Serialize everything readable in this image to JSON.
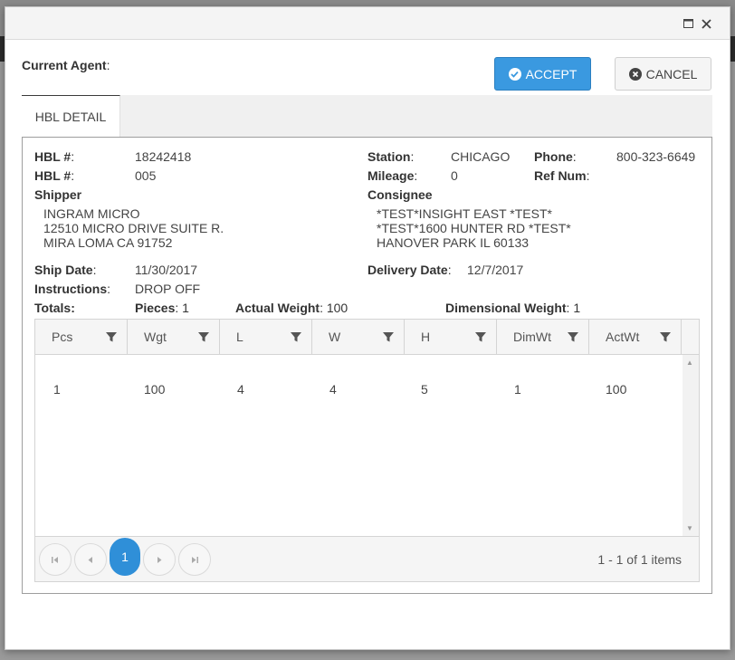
{
  "window": {
    "maximize_icon": "maximize-icon",
    "close_icon": "close-icon"
  },
  "agent": {
    "label": "Current Agent",
    "colon": ":"
  },
  "actions": {
    "accept_label": "ACCEPT",
    "cancel_label": "CANCEL",
    "accept_color": "#3a99e0"
  },
  "tabs": [
    {
      "label": "HBL DETAIL",
      "active": true
    }
  ],
  "detail": {
    "hbl1": {
      "label": "HBL #",
      "value": "18242418"
    },
    "hbl2": {
      "label": "HBL #",
      "value": "005"
    },
    "station": {
      "label": "Station",
      "value": "CHICAGO"
    },
    "phone": {
      "label": "Phone",
      "value": "800-323-6649"
    },
    "mileage": {
      "label": "Mileage",
      "value": "0"
    },
    "ref_num": {
      "label": "Ref Num",
      "value": ""
    },
    "shipper": {
      "label": "Shipper",
      "lines": [
        "INGRAM MICRO",
        "12510 MICRO DRIVE SUITE R.",
        "MIRA LOMA CA 91752"
      ]
    },
    "consignee": {
      "label": "Consignee",
      "lines": [
        "*TEST*INSIGHT EAST *TEST*",
        "*TEST*1600 HUNTER RD *TEST*",
        "HANOVER PARK IL 60133"
      ]
    },
    "ship_date": {
      "label": "Ship Date",
      "value": "11/30/2017"
    },
    "delivery_date": {
      "label": "Delivery Date",
      "value": "12/7/2017"
    },
    "instructions": {
      "label": "Instructions",
      "value": "DROP OFF"
    },
    "totals": {
      "label": "Totals:",
      "pieces_label": "Pieces",
      "pieces": "1",
      "actual_weight_label": "Actual Weight",
      "actual_weight": "100",
      "dim_weight_label": "Dimensional Weight",
      "dim_weight": "1"
    }
  },
  "grid": {
    "columns": [
      "Pcs",
      "Wgt",
      "L",
      "W",
      "H",
      "DimWt",
      "ActWt"
    ],
    "rows": [
      [
        "1",
        "100",
        "4",
        "4",
        "5",
        "1",
        "100"
      ]
    ],
    "pager": {
      "current_page": "1",
      "info": "1 - 1 of 1 items"
    }
  }
}
